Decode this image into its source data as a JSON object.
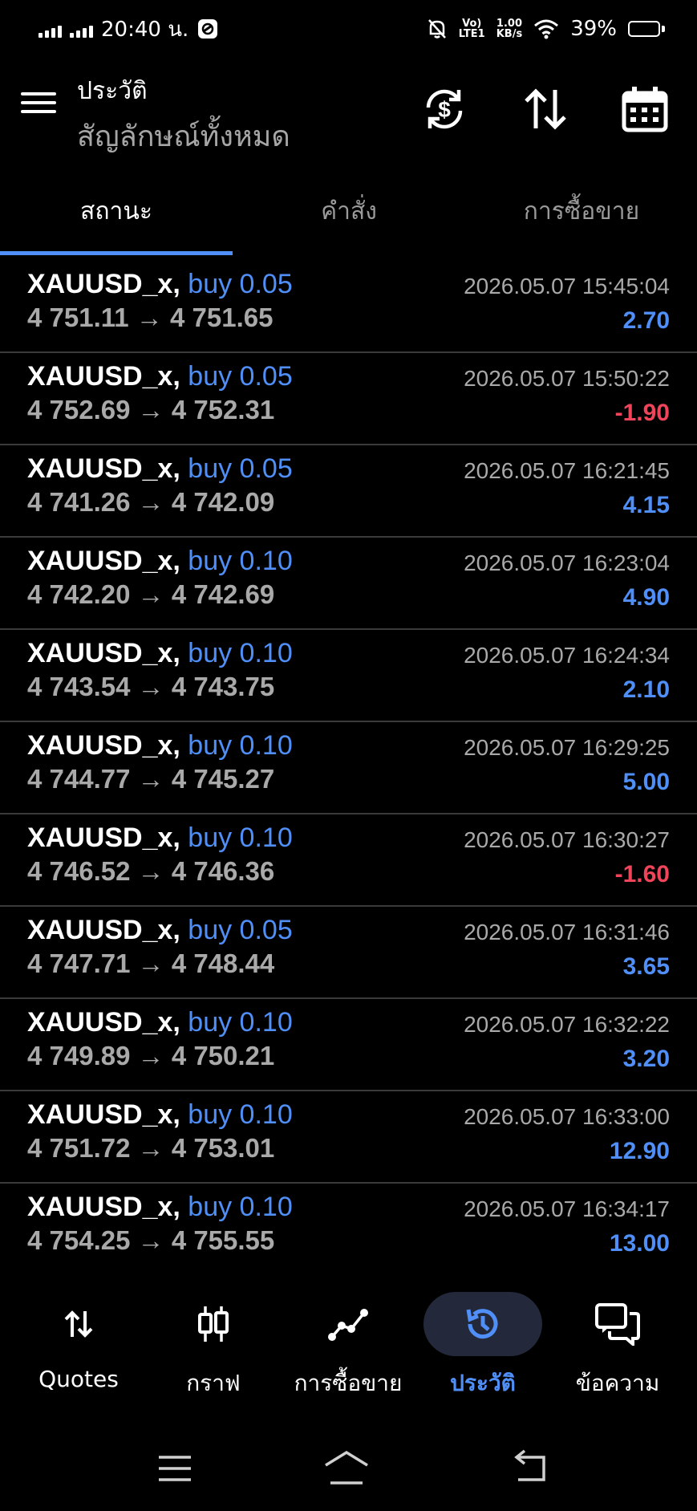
{
  "status": {
    "time": "20:40 น.",
    "net_speed_top": "1.00",
    "net_speed_bottom": "KB/s",
    "volte_top": "Vo)",
    "volte_bottom": "LTE1",
    "battery": "39%",
    "battery_level": 0.39
  },
  "app_bar": {
    "title": "ประวัติ",
    "subtitle": "สัญลักษณ์ทั้งหมด"
  },
  "tabs": [
    {
      "label": "สถานะ",
      "active": true
    },
    {
      "label": "คำสั่ง",
      "active": false
    },
    {
      "label": "การซื้อขาย",
      "active": false
    }
  ],
  "arrow": "→",
  "trades": [
    {
      "symbol": "XAUUSD_x,",
      "side": "buy 0.05",
      "open": "4 751.11",
      "close": "4 751.65",
      "time": "2026.05.07 15:45:04",
      "profit": "2.70"
    },
    {
      "symbol": "XAUUSD_x,",
      "side": "buy 0.05",
      "open": "4 752.69",
      "close": "4 752.31",
      "time": "2026.05.07 15:50:22",
      "profit": "-1.90"
    },
    {
      "symbol": "XAUUSD_x,",
      "side": "buy 0.05",
      "open": "4 741.26",
      "close": "4 742.09",
      "time": "2026.05.07 16:21:45",
      "profit": "4.15"
    },
    {
      "symbol": "XAUUSD_x,",
      "side": "buy 0.10",
      "open": "4 742.20",
      "close": "4 742.69",
      "time": "2026.05.07 16:23:04",
      "profit": "4.90"
    },
    {
      "symbol": "XAUUSD_x,",
      "side": "buy 0.10",
      "open": "4 743.54",
      "close": "4 743.75",
      "time": "2026.05.07 16:24:34",
      "profit": "2.10"
    },
    {
      "symbol": "XAUUSD_x,",
      "side": "buy 0.10",
      "open": "4 744.77",
      "close": "4 745.27",
      "time": "2026.05.07 16:29:25",
      "profit": "5.00"
    },
    {
      "symbol": "XAUUSD_x,",
      "side": "buy 0.10",
      "open": "4 746.52",
      "close": "4 746.36",
      "time": "2026.05.07 16:30:27",
      "profit": "-1.60"
    },
    {
      "symbol": "XAUUSD_x,",
      "side": "buy 0.05",
      "open": "4 747.71",
      "close": "4 748.44",
      "time": "2026.05.07 16:31:46",
      "profit": "3.65"
    },
    {
      "symbol": "XAUUSD_x,",
      "side": "buy 0.10",
      "open": "4 749.89",
      "close": "4 750.21",
      "time": "2026.05.07 16:32:22",
      "profit": "3.20"
    },
    {
      "symbol": "XAUUSD_x,",
      "side": "buy 0.10",
      "open": "4 751.72",
      "close": "4 753.01",
      "time": "2026.05.07 16:33:00",
      "profit": "12.90"
    },
    {
      "symbol": "XAUUSD_x,",
      "side": "buy 0.10",
      "open": "4 754.25",
      "close": "4 755.55",
      "time": "2026.05.07 16:34:17",
      "profit": "13.00"
    }
  ],
  "bottom_nav": [
    {
      "label": "Quotes",
      "icon": "quotes-arrows-icon",
      "active": false
    },
    {
      "label": "กราฟ",
      "icon": "chart-candles-icon",
      "active": false
    },
    {
      "label": "การซื้อขาย",
      "icon": "trade-line-icon",
      "active": false
    },
    {
      "label": "ประวัติ",
      "icon": "history-clock-icon",
      "active": true
    },
    {
      "label": "ข้อความ",
      "icon": "messages-chat-icon",
      "active": false
    }
  ],
  "colors": {
    "accent": "#4f8ff7",
    "positive": "#4f8ff7",
    "negative": "#f0445a",
    "muted": "#a9a9a9",
    "divider": "#3a3a3a"
  }
}
